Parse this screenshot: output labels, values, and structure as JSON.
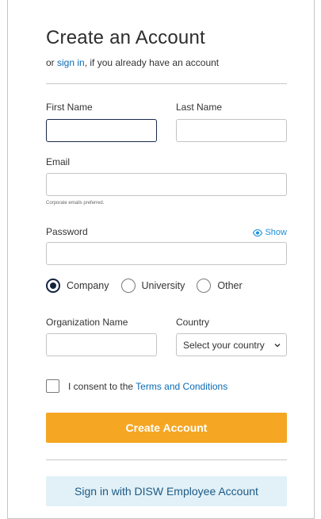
{
  "header": {
    "title": "Create an Account",
    "subtitle_prefix": "or ",
    "signin_link": "sign in",
    "subtitle_suffix": ", if you already have an account"
  },
  "form": {
    "first_name": {
      "label": "First Name",
      "value": ""
    },
    "last_name": {
      "label": "Last Name",
      "value": ""
    },
    "email": {
      "label": "Email",
      "value": "",
      "hint": "Corporate emails preferred."
    },
    "password": {
      "label": "Password",
      "value": "",
      "show_label": "Show"
    },
    "account_type": {
      "selected": "Company",
      "options": [
        "Company",
        "University",
        "Other"
      ]
    },
    "organization_name": {
      "label": "Organization Name",
      "value": ""
    },
    "country": {
      "label": "Country",
      "selected_text": "Select your country"
    },
    "consent": {
      "checked": false,
      "text_prefix": "I consent to the ",
      "link": "Terms and Conditions"
    }
  },
  "actions": {
    "create_account": "Create Account",
    "employee_signin": "Sign in with DISW Employee Account"
  },
  "colors": {
    "primary_button": "#f5a623",
    "link": "#0c6bb3",
    "show_toggle": "#1c8fdb",
    "secondary_button_bg": "#e2f1f7",
    "secondary_button_text": "#1b5a86",
    "radio_checked": "#13233f"
  },
  "icons": {
    "show_password": "eye-icon",
    "country_dropdown": "chevron-down-icon"
  }
}
